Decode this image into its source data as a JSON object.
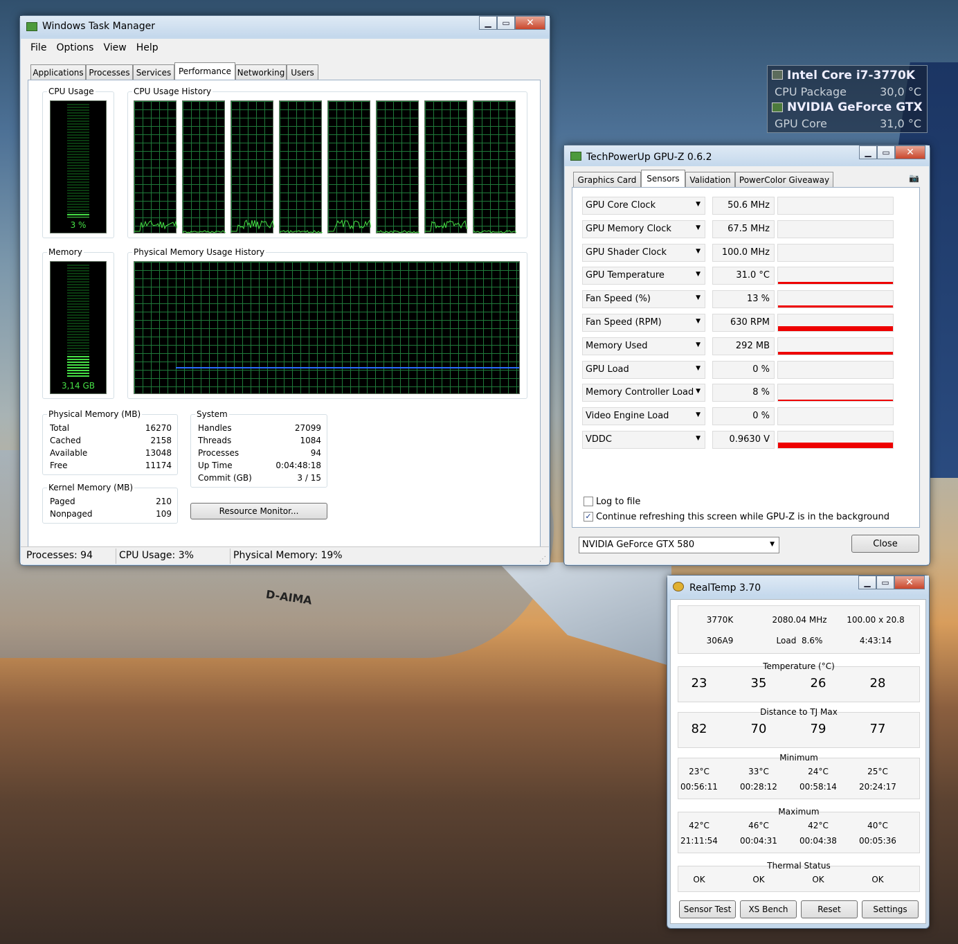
{
  "desktop_widget": {
    "cpu_name": "Intel Core i7-3770K",
    "cpu_sensor": "CPU Package",
    "cpu_value": "30,0 °C",
    "gpu_name": "NVIDIA GeForce GTX",
    "gpu_sensor": "GPU Core",
    "gpu_value": "31,0 °C"
  },
  "task_manager": {
    "title": "Windows Task Manager",
    "menu": [
      "File",
      "Options",
      "View",
      "Help"
    ],
    "tabs": [
      "Applications",
      "Processes",
      "Services",
      "Performance",
      "Networking",
      "Users"
    ],
    "active_tab": "Performance",
    "cpu_usage_label": "CPU Usage",
    "cpu_usage_value": "3 %",
    "cpu_usage_fraction": 0.03,
    "cpu_history_label": "CPU Usage History",
    "cpu_cores": 8,
    "memory_label": "Memory",
    "memory_value": "3,14 GB",
    "memory_fraction": 0.19,
    "phys_history_label": "Physical Memory Usage History",
    "physical_memory": {
      "label": "Physical Memory (MB)",
      "rows": [
        [
          "Total",
          "16270"
        ],
        [
          "Cached",
          "2158"
        ],
        [
          "Available",
          "13048"
        ],
        [
          "Free",
          "11174"
        ]
      ]
    },
    "kernel_memory": {
      "label": "Kernel Memory (MB)",
      "rows": [
        [
          "Paged",
          "210"
        ],
        [
          "Nonpaged",
          "109"
        ]
      ]
    },
    "system": {
      "label": "System",
      "rows": [
        [
          "Handles",
          "27099"
        ],
        [
          "Threads",
          "1084"
        ],
        [
          "Processes",
          "94"
        ],
        [
          "Up Time",
          "0:04:48:18"
        ],
        [
          "Commit (GB)",
          "3 / 15"
        ]
      ]
    },
    "resource_monitor_button": "Resource Monitor...",
    "status": {
      "processes": "Processes: 94",
      "cpu": "CPU Usage: 3%",
      "memory": "Physical Memory: 19%"
    }
  },
  "gpuz": {
    "title": "TechPowerUp GPU-Z 0.6.2",
    "tabs": [
      "Graphics Card",
      "Sensors",
      "Validation",
      "PowerColor Giveaway"
    ],
    "active_tab": "Sensors",
    "sensors": [
      {
        "name": "GPU Core Clock",
        "value": "50.6 MHz",
        "level": 0
      },
      {
        "name": "GPU Memory Clock",
        "value": "67.5 MHz",
        "level": 0
      },
      {
        "name": "GPU Shader Clock",
        "value": "100.0 MHz",
        "level": 0
      },
      {
        "name": "GPU Temperature",
        "value": "31.0 °C",
        "level": 0.12
      },
      {
        "name": "Fan Speed (%)",
        "value": "13 %",
        "level": 0.13
      },
      {
        "name": "Fan Speed (RPM)",
        "value": "630 RPM",
        "level": 0.25
      },
      {
        "name": "Memory Used",
        "value": "292 MB",
        "level": 0.15
      },
      {
        "name": "GPU Load",
        "value": "0 %",
        "level": 0
      },
      {
        "name": "Memory Controller Load",
        "value": "8 %",
        "level": 0.08
      },
      {
        "name": "Video Engine Load",
        "value": "0 %",
        "level": 0
      },
      {
        "name": "VDDC",
        "value": "0.9630 V",
        "level": 0.3
      }
    ],
    "log_to_file": "Log to file",
    "log_checked": false,
    "continue_refresh": "Continue refreshing this screen while GPU-Z is in the background",
    "refresh_checked": true,
    "gpu_select": "NVIDIA GeForce GTX 580",
    "close_button": "Close"
  },
  "realtemp": {
    "title": "RealTemp 3.70",
    "info": {
      "cpu": "3770K",
      "mhz": "2080.04 MHz",
      "multi": "100.00 x 20.8",
      "cpuid": "306A9",
      "load": "Load  8.6%",
      "time": "4:43:14"
    },
    "temperature_label": "Temperature (°C)",
    "temperatures": [
      "23",
      "35",
      "26",
      "28"
    ],
    "tj_label": "Distance to TJ Max",
    "tj": [
      "82",
      "70",
      "79",
      "77"
    ],
    "min_label": "Minimum",
    "min_temps": [
      "23°C",
      "33°C",
      "24°C",
      "25°C"
    ],
    "min_times": [
      "00:56:11",
      "00:28:12",
      "00:58:14",
      "20:24:17"
    ],
    "max_label": "Maximum",
    "max_temps": [
      "42°C",
      "46°C",
      "42°C",
      "40°C"
    ],
    "max_times": [
      "21:11:54",
      "00:04:31",
      "00:04:38",
      "00:05:36"
    ],
    "thermal_label": "Thermal Status",
    "thermal": [
      "OK",
      "OK",
      "OK",
      "OK"
    ],
    "buttons": [
      "Sensor Test",
      "XS Bench",
      "Reset",
      "Settings"
    ]
  },
  "plane_text": "D-AIMA"
}
